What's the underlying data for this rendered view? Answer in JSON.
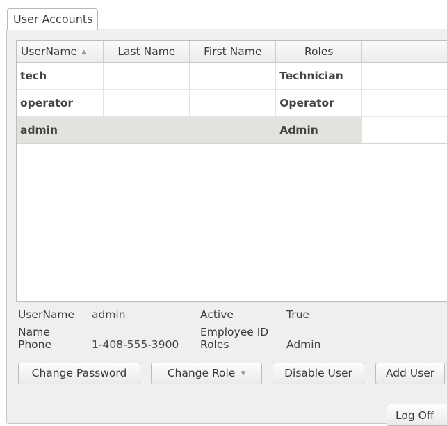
{
  "tab": {
    "label": "User Accounts"
  },
  "table": {
    "columns": [
      {
        "label": "UserName",
        "sort_indicator": "▲"
      },
      {
        "label": "Last Name"
      },
      {
        "label": "First Name"
      },
      {
        "label": "Roles"
      }
    ],
    "rows": [
      {
        "username": "tech",
        "last_name": "",
        "first_name": "",
        "roles": "Technician",
        "selected": false
      },
      {
        "username": "operator",
        "last_name": "",
        "first_name": "",
        "roles": "Operator",
        "selected": false
      },
      {
        "username": "admin",
        "last_name": "",
        "first_name": "",
        "roles": "Admin",
        "selected": true
      }
    ]
  },
  "details": {
    "username_label": "UserName",
    "username_value": "admin",
    "name_label": "Name",
    "name_value": "",
    "phone_label": "Phone",
    "phone_value": "1-408-555-3900",
    "active_label": "Active",
    "active_value": "True",
    "employee_id_label": "Employee ID",
    "employee_id_value": "",
    "roles_label": "Roles",
    "roles_value": "Admin"
  },
  "buttons": {
    "change_password": "Change Password",
    "change_role": "Change Role",
    "change_role_arrow": "▼",
    "disable_user": "Disable User",
    "add_user": "Add User",
    "log_off": "Log Off"
  }
}
